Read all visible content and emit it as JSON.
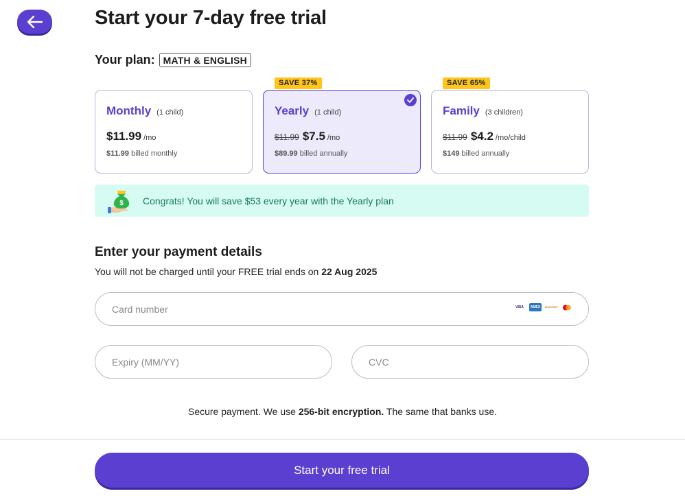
{
  "header": {
    "title": "Start your 7-day free trial",
    "back_icon": "arrow-left-icon"
  },
  "plan": {
    "label": "Your plan:",
    "tag": "MATH & ENGLISH"
  },
  "plans": [
    {
      "name": "Monthly",
      "sub": "(1 child)",
      "old_price": "",
      "price": "$11.99",
      "unit": "/mo",
      "billed_amount": "$11.99",
      "billed_text": "billed monthly",
      "badge": "",
      "selected": false
    },
    {
      "name": "Yearly",
      "sub": "(1 child)",
      "old_price": "$11.99",
      "price": "$7.5",
      "unit": "/mo",
      "billed_amount": "$89.99",
      "billed_text": "billed annually",
      "badge": "SAVE 37%",
      "selected": true
    },
    {
      "name": "Family",
      "sub": "(3 children)",
      "old_price": "$11.99",
      "price": "$4.2",
      "unit": "/mo/child",
      "billed_amount": "$149",
      "billed_text": "billed annually",
      "badge": "SAVE 65%",
      "selected": false
    }
  ],
  "congrats": {
    "icon": "money-bag-icon",
    "text": "Congrats! You will save $53 every year with the Yearly plan"
  },
  "payment": {
    "title": "Enter your payment details",
    "subtitle_prefix": "You will not be charged until your FREE trial ends on",
    "trial_end_date": "22 Aug 2025",
    "card_placeholder": "Card number",
    "card_logos": [
      "VISA",
      "AMEX",
      "DISCOVER",
      "MC"
    ],
    "expiry_placeholder": "Expiry (MM/YY)",
    "cvc_placeholder": "CVC"
  },
  "secure": {
    "prefix": "Secure payment. We use",
    "bold": "256-bit encryption.",
    "suffix": "The same that banks use."
  },
  "cta": {
    "label": "Start your free trial"
  },
  "colors": {
    "primary": "#5a3fd0",
    "badge": "#ffc51a",
    "congrats_bg": "#d5fbf3",
    "congrats_text": "#1b7a5a"
  }
}
